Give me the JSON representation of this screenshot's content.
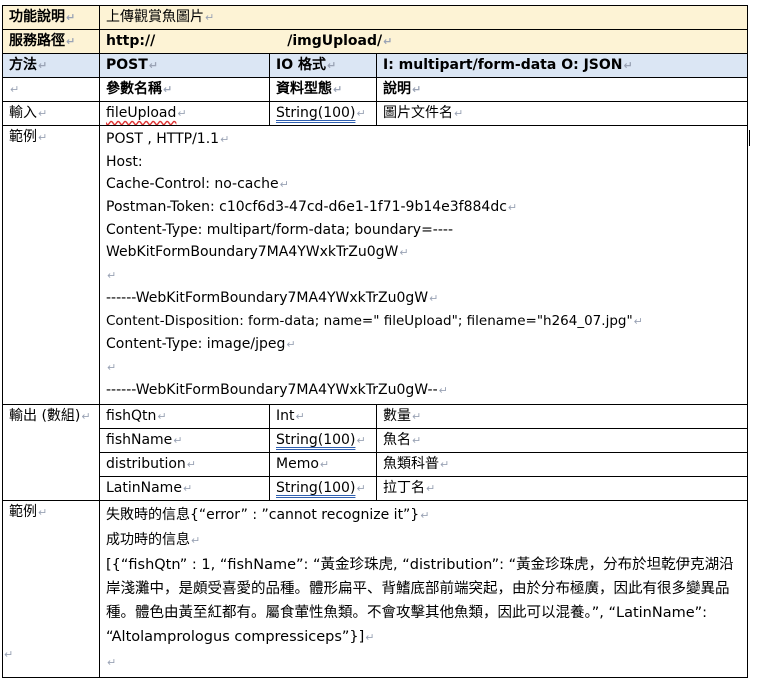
{
  "rows": {
    "func_label": "功能說明",
    "func_value": "上傳觀賞魚圖片",
    "path_label": "服務路徑",
    "path_value_prefix": "http://",
    "path_value_suffix": "/imgUpload/",
    "method_label": "方法",
    "method_value": "POST",
    "io_label": "IO 格式",
    "io_value": "I: multipart/form-data  O: JSON",
    "param_name_h": "參數名稱",
    "param_type_h": "資料型態",
    "param_desc_h": "說明",
    "input_label": "輸入",
    "input_name": "fileUpload",
    "input_type": "String(100)",
    "input_desc": "圖片文件名",
    "example_label": "範例",
    "example_lines": [
      "POST ,                 HTTP/1.1",
      "Host:",
      "Cache-Control: no-cache",
      "Postman-Token: c10cf6d3-47cd-d6e1-1f71-9b14e3f884dc",
      "Content-Type: multipart/form-data; boundary=----",
      "WebKitFormBoundary7MA4YWxkTrZu0gW",
      "",
      "------WebKitFormBoundary7MA4YWxkTrZu0gW",
      "Content-Disposition: form-data; name=\" fileUpload\"; filename=\"h264_07.jpg\"",
      "Content-Type: image/jpeg",
      "",
      "------WebKitFormBoundary7MA4YWxkTrZu0gW--"
    ],
    "output_label": "輸出 (數組)",
    "outputs": [
      {
        "name": "fishQtn",
        "type": "Int",
        "desc": "數量"
      },
      {
        "name": "fishName",
        "type": "String(100)",
        "desc": "魚名"
      },
      {
        "name": "distribution",
        "type": "Memo",
        "desc": "魚類科普"
      },
      {
        "name": "LatinName",
        "type": "String(100)",
        "desc": "拉丁名"
      }
    ],
    "example2_label": "範例",
    "fail_line": "失敗時的信息{“error” : ”cannot recognize it”}",
    "success_label": "成功時的信息",
    "success_json": "[{“fishQtn” : 1, “fishName”: “黃金珍珠虎, “distribution”: “黃金珍珠虎，分布於坦乾伊克湖沿岸淺灘中，是頗受喜愛的品種。體形扁平、背鰭底部前端突起，由於分布極廣，因此有很多變異品種。體色由黃至紅都有。屬食葷性魚類。不會攻擊其他魚類，因此可以混養。”, “LatinName”: “Altolamprologus compressiceps”}]"
  },
  "colors": {
    "header_bg": "#fdf3d5",
    "subheader_bg": "#dbe6f4",
    "para_mark": "#9aa3b5"
  },
  "para_mark_glyph": "↵"
}
